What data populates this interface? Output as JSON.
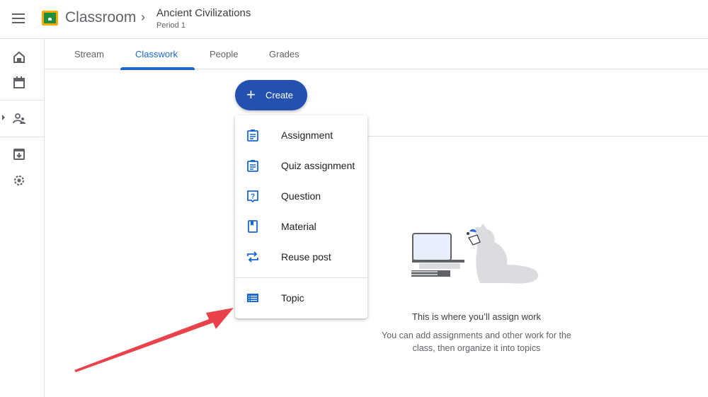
{
  "header": {
    "app_name": "Classroom",
    "breadcrumb_separator": "›",
    "class_name": "Ancient Civilizations",
    "class_section": "Period 1",
    "menu_icon": "hamburger-menu-icon",
    "logo_icon": "google-classroom-logo"
  },
  "sidenav": {
    "items": [
      {
        "name": "home",
        "icon": "home-icon"
      },
      {
        "name": "calendar",
        "icon": "calendar-icon"
      },
      {
        "name": "enrolled",
        "icon": "people-icon"
      },
      {
        "name": "archived",
        "icon": "archive-icon"
      },
      {
        "name": "settings",
        "icon": "gear-icon"
      }
    ]
  },
  "tabs": [
    {
      "label": "Stream",
      "active": false
    },
    {
      "label": "Classwork",
      "active": true
    },
    {
      "label": "People",
      "active": false
    },
    {
      "label": "Grades",
      "active": false
    }
  ],
  "create_button": {
    "label": "Create",
    "icon": "plus-icon"
  },
  "create_menu": {
    "items": [
      {
        "label": "Assignment",
        "icon": "assignment-icon"
      },
      {
        "label": "Quiz assignment",
        "icon": "quiz-assignment-icon"
      },
      {
        "label": "Question",
        "icon": "question-icon"
      },
      {
        "label": "Material",
        "icon": "material-icon"
      },
      {
        "label": "Reuse post",
        "icon": "reuse-icon"
      },
      {
        "label": "Topic",
        "icon": "topic-icon"
      }
    ]
  },
  "empty_state": {
    "title": "This is where you’ll assign work",
    "description": "You can add assignments and other work for the class, then organize it into topics"
  },
  "colors": {
    "accent": "#1967d2",
    "create_button": "#2451b0",
    "annotation_arrow": "#e8434a"
  }
}
